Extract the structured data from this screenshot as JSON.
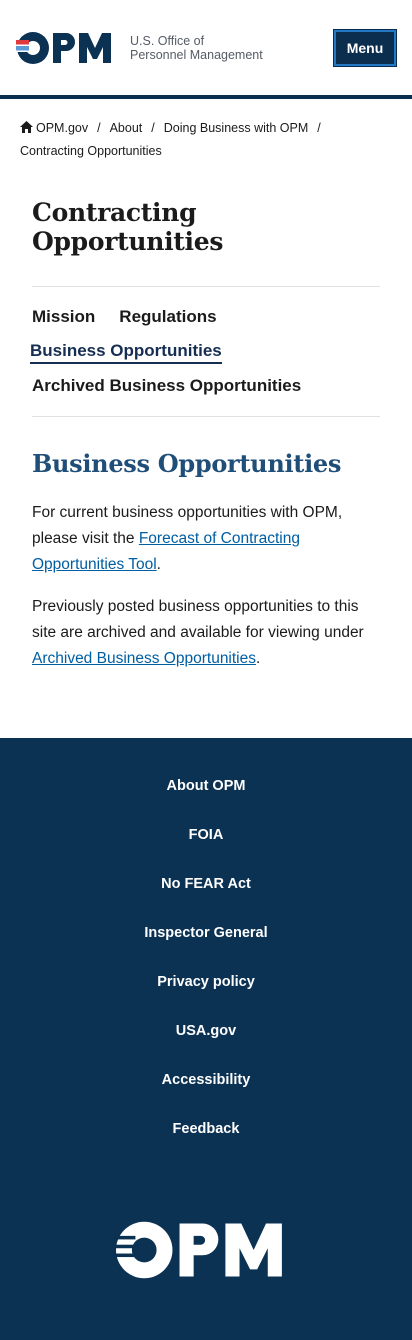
{
  "header": {
    "logo_text": "OPM",
    "agency_line1": "U.S. Office of",
    "agency_line2": "Personnel Management",
    "menu_label": "Menu"
  },
  "breadcrumb": {
    "items": [
      "OPM.gov",
      "About",
      "Doing Business with OPM"
    ],
    "current": "Contracting Opportunities",
    "separator": "/"
  },
  "page": {
    "title": "Contracting Opportunities"
  },
  "subnav": {
    "items": [
      "Mission",
      "Regulations",
      "Business Opportunities",
      "Archived Business Opportunities"
    ],
    "active": "Business Opportunities"
  },
  "section": {
    "title": "Business Opportunities",
    "p1_text": "For current business opportunities with OPM, please visit the ",
    "p1_link": "Forecast of Contracting Opportunities Tool",
    "p1_end": ".",
    "p2_text": "Previously posted business opportunities to this site are archived and available for viewing under ",
    "p2_link": "Archived Business Opportunities",
    "p2_end": "."
  },
  "footer": {
    "links": [
      "About OPM",
      "FOIA",
      "No FEAR Act",
      "Inspector General",
      "Privacy policy",
      "USA.gov",
      "Accessibility",
      "Feedback"
    ],
    "logo_text": "OPM"
  },
  "colors": {
    "navy": "#0b3153",
    "link": "#005ea2",
    "logo_red": "#e03a3e",
    "logo_blue": "#5b9bd5"
  }
}
